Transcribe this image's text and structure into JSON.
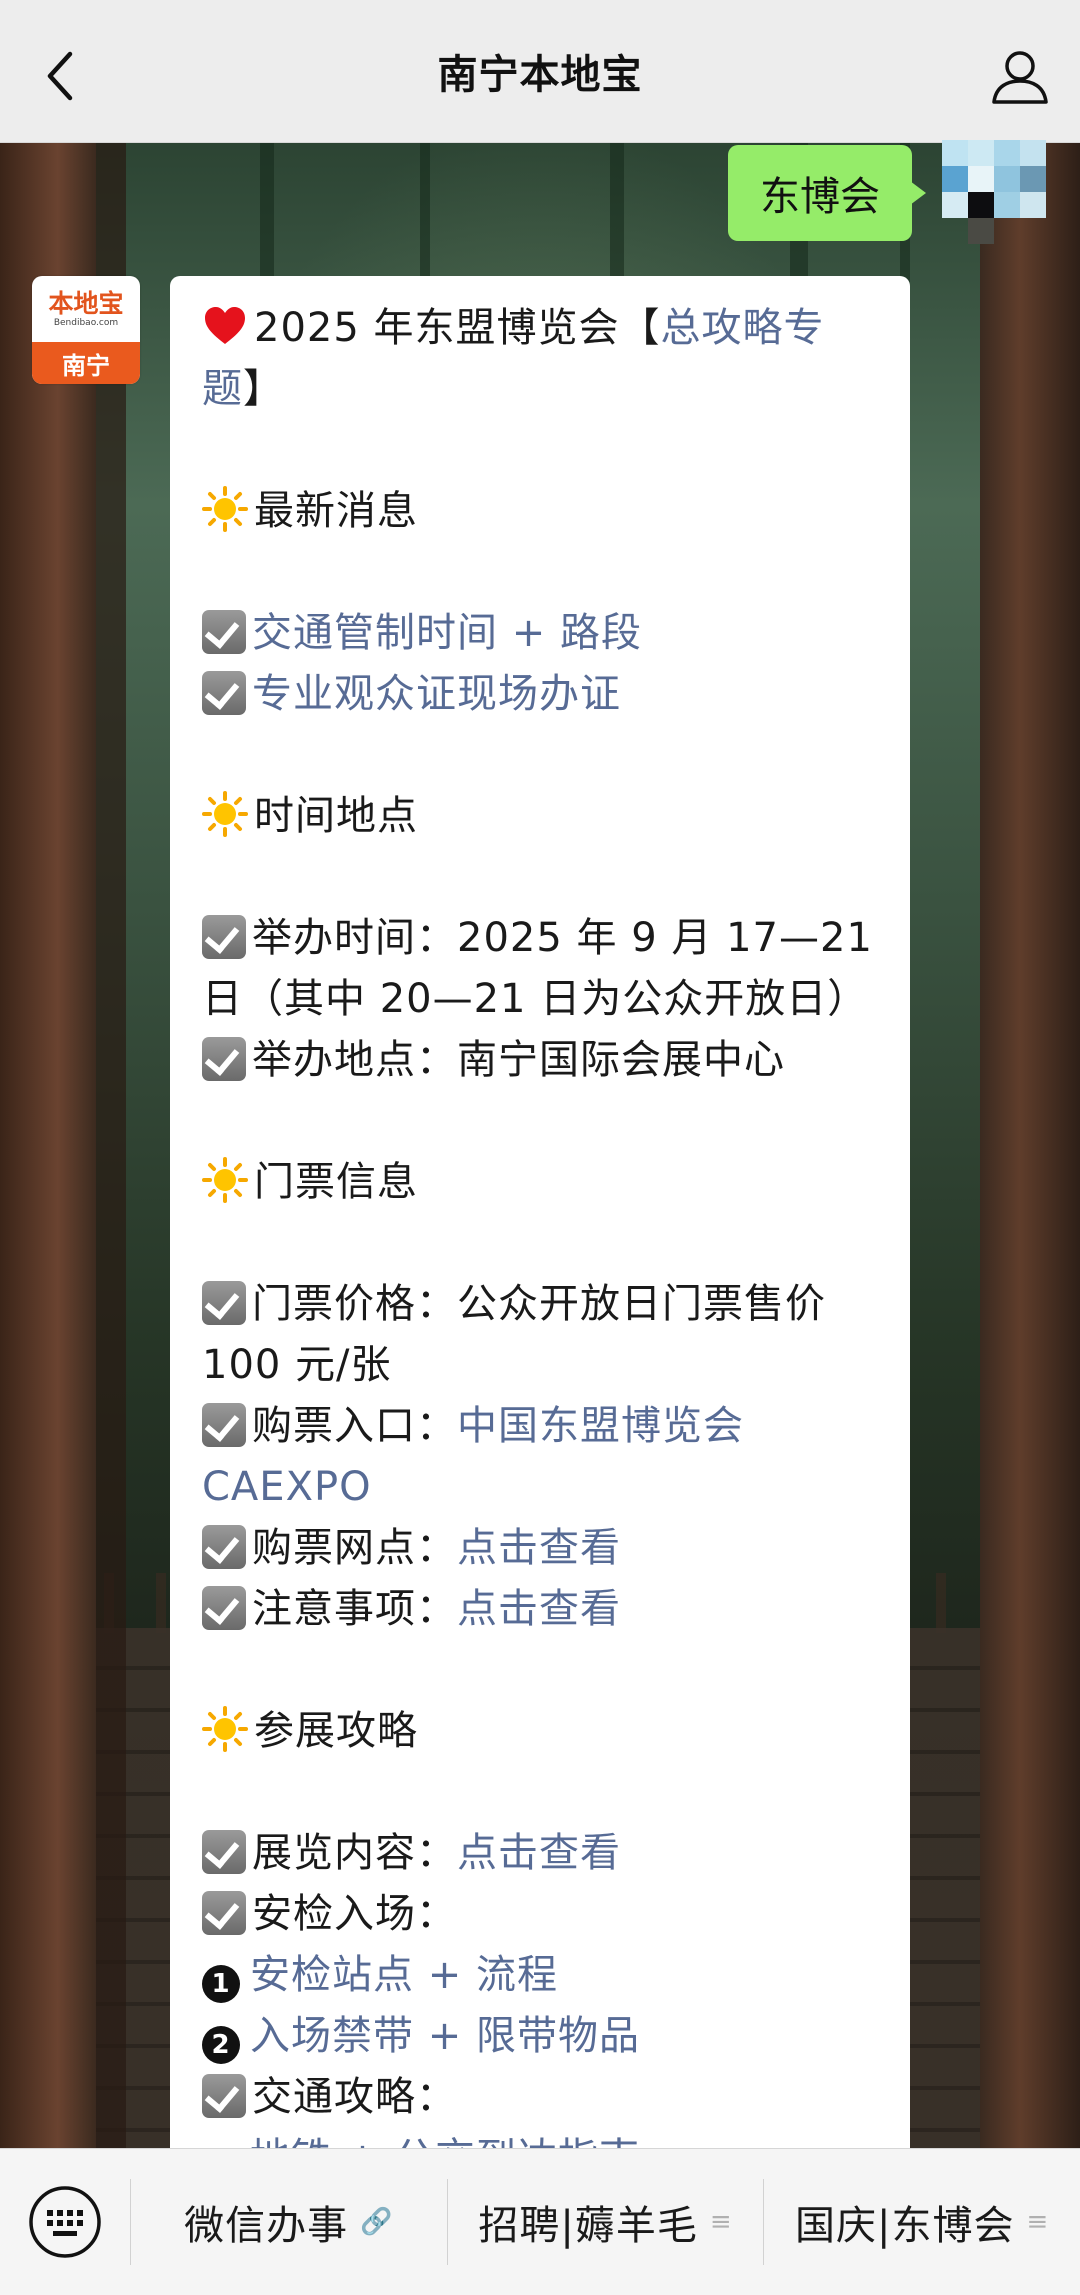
{
  "header": {
    "title": "南宁本地宝"
  },
  "sent_message": {
    "text": "东博会"
  },
  "bot_avatar": {
    "name": "本地宝",
    "url": "Bendibao.com",
    "city": "南宁"
  },
  "article": {
    "intro": {
      "prefix": "2025 年东盟博览会【",
      "link": "总攻略专题",
      "suffix": "】"
    },
    "sections": {
      "latest": {
        "heading": "最新消息",
        "items": [
          "交通管制时间 + 路段",
          "专业观众证现场办证"
        ]
      },
      "time_place": {
        "heading": "时间地点",
        "time": "举办时间：2025 年 9 月 17—21 日（其中 20—21 日为公众开放日）",
        "place": "举办地点：南宁国际会展中心"
      },
      "tickets": {
        "heading": "门票信息",
        "price": "门票价格：公众开放日门票售价 100 元/张",
        "buy_label": "购票入口：",
        "buy_link": "中国东盟博览会 CAEXPO",
        "outlets_label": "购票网点：",
        "outlets_link": "点击查看",
        "notes_label": "注意事项：",
        "notes_link": "点击查看"
      },
      "guide": {
        "heading": "参展攻略",
        "content_label": "展览内容：",
        "content_link": "点击查看",
        "security_label": "安检入场：",
        "security_1": "安检站点 + 流程",
        "security_2": "入场禁带 + 限带物品",
        "traffic_label": "交通攻略：",
        "traffic_1": "地铁 + 公交到达指南"
      }
    }
  },
  "bottom_menu": {
    "items": [
      {
        "label": "微信办事",
        "icon": "link-icon"
      },
      {
        "label": "招聘|薅羊毛",
        "icon": "menu-icon"
      },
      {
        "label": "国庆|东博会",
        "icon": "menu-icon"
      }
    ]
  },
  "colors": {
    "link": "#576b95",
    "sent_bubble": "#95ec69",
    "accent_orange": "#ea5a1e"
  }
}
